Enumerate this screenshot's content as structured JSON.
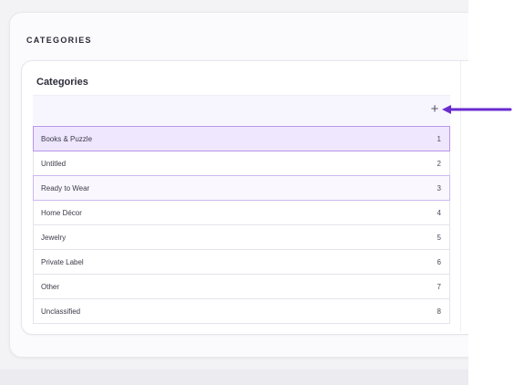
{
  "section_title": "CATEGORIES",
  "card": {
    "title": "Categories",
    "add_label": "+"
  },
  "categories": [
    {
      "name": "Books & Puzzle",
      "order": "1"
    },
    {
      "name": "Untitled",
      "order": "2"
    },
    {
      "name": "Ready to Wear",
      "order": "3"
    },
    {
      "name": "Home Décor",
      "order": "4"
    },
    {
      "name": "Jewelry",
      "order": "5"
    },
    {
      "name": "Private Label",
      "order": "6"
    },
    {
      "name": "Other",
      "order": "7"
    },
    {
      "name": "Unclassified",
      "order": "8"
    }
  ],
  "colors": {
    "accent": "#6a2bd0",
    "selected_row": "#efe7fd",
    "selected_border": "#b694ea"
  },
  "icons": {
    "add": "plus-icon",
    "pointer": "arrow-left-icon"
  }
}
